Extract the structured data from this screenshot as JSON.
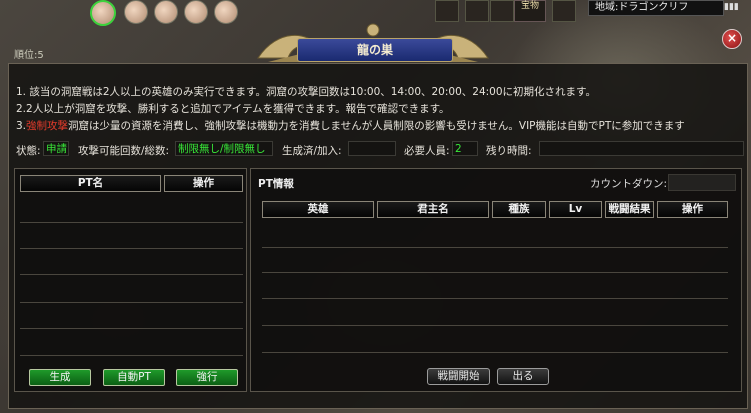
{
  "topbar": {
    "treasure_label": "宝物",
    "region_label": "地域:ドラゴンクリフ",
    "rank_label": "順位:5"
  },
  "dialog": {
    "title": "龍の巣",
    "close_icon": "close-icon",
    "info": {
      "line1": "1. 該当の洞窟戦は2人以上の英雄のみ実行できます。洞窟の攻撃回数は10:00、14:00、20:00、24:00に初期化されます。",
      "line2": "2.2人以上が洞窟を攻撃、勝利すると追加でアイテムを獲得できます。報告で確認できます。",
      "line3_prefix": "3.",
      "line3_red": "強制攻撃",
      "line3_rest": "洞窟は少量の資源を消費し、強制攻撃は機動力を消費しませんが人員制限の影響も受けません。VIP機能は自動でPTに参加できます"
    },
    "status": {
      "state_label": "状態:",
      "state_value": "申請",
      "attack_label": "攻撃可能回数/総数:",
      "attack_value": "制限無し/制限無し",
      "created_label": "生成済/加入:",
      "created_value": "",
      "required_label": "必要人員:",
      "required_value": "2",
      "remaining_label": "残り時間:",
      "remaining_value": ""
    },
    "left_panel": {
      "columns": [
        "PT名",
        "操作"
      ],
      "buttons": {
        "create": "生成",
        "auto_pt": "自動PT",
        "force": "強行"
      }
    },
    "right_panel": {
      "title": "PT情報",
      "countdown_label": "カウントダウン:",
      "columns": [
        "英雄",
        "君主名",
        "種族",
        "Lv",
        "戦闘結果",
        "操作"
      ],
      "buttons": {
        "start_battle": "戦闘開始",
        "leave": "出る"
      }
    }
  },
  "colors": {
    "accent_green": "#38e838",
    "warning_red": "#e23b2b",
    "title_plate": "#2a3a88"
  }
}
